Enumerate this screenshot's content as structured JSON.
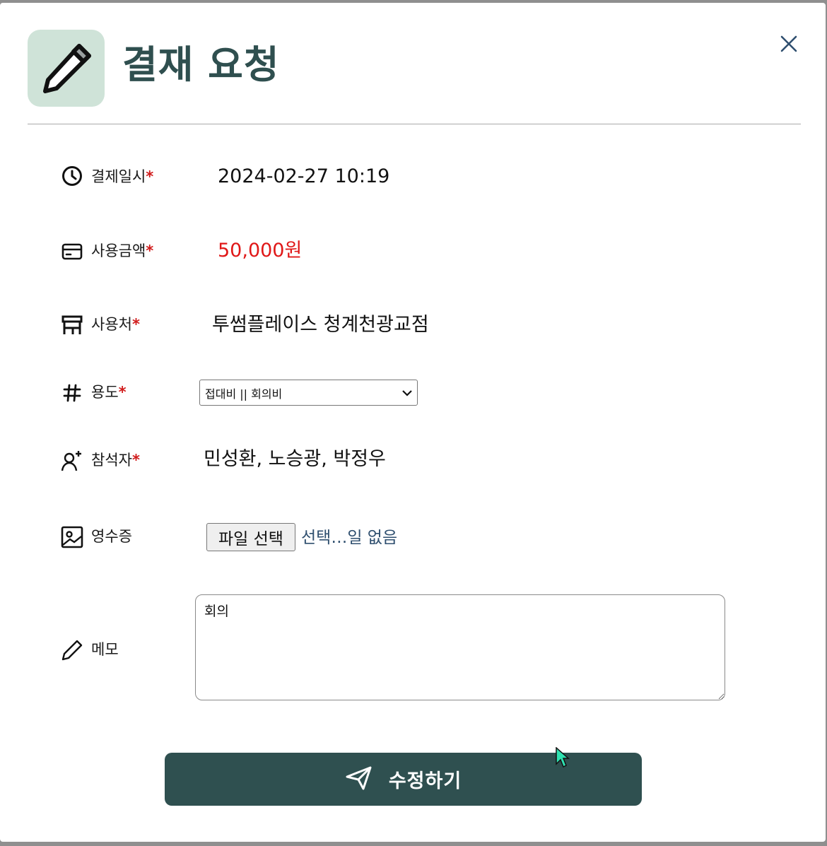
{
  "header": {
    "title": "결재 요청",
    "icon": "pencil-icon",
    "icon_bg": "#cfe3d8",
    "close_icon": "close-icon"
  },
  "fields": {
    "datetime": {
      "label": "결제일시",
      "required_mark": "*",
      "value": "2024-02-27 10:19",
      "icon": "clock-icon"
    },
    "amount": {
      "label": "사용금액",
      "required_mark": "*",
      "value": "50,000원",
      "value_color": "#e01818",
      "icon": "credit-card-icon"
    },
    "merchant": {
      "label": "사용처",
      "required_mark": "*",
      "value": "투썸플레이스 청계천광교점",
      "icon": "store-icon"
    },
    "purpose": {
      "label": "용도",
      "required_mark": "*",
      "selected": "접대비 || 회의비",
      "icon": "hash-icon"
    },
    "attendees": {
      "label": "참석자",
      "required_mark": "*",
      "value": "민성환, 노승광, 박정우",
      "icon": "add-person-icon"
    },
    "receipt": {
      "label": "영수증",
      "button_label": "파일 선택",
      "status": "선택…일 없음",
      "icon": "image-icon"
    },
    "memo": {
      "label": "메모",
      "value": "회의",
      "icon": "pencil-icon"
    }
  },
  "submit": {
    "label": "수정하기",
    "icon": "send-icon",
    "bg_color": "#2f5050"
  },
  "colors": {
    "accent": "#2f4f4f",
    "required": "#d11b1b"
  }
}
